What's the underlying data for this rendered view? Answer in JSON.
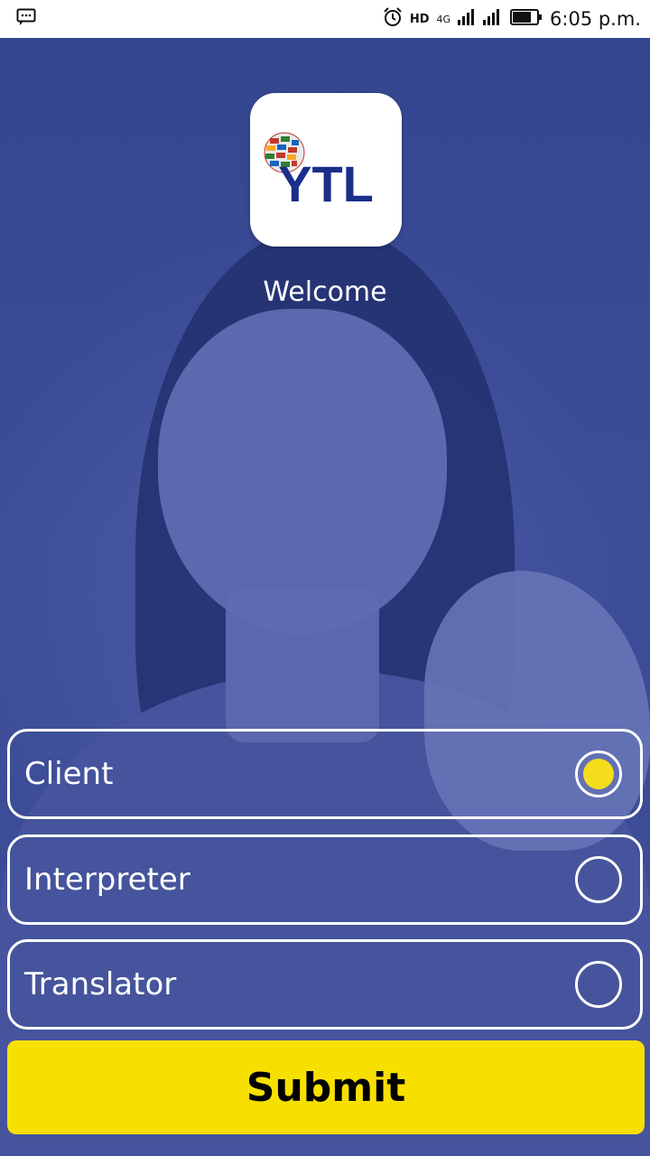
{
  "status_bar": {
    "notification_icon": "message-icon",
    "network_label": "4G",
    "hd_label": "HD",
    "time": "6:05 p.m."
  },
  "logo": {
    "text": "YTL",
    "brand_color": "#1a2e8a"
  },
  "welcome": "Welcome",
  "options": [
    {
      "label": "Client",
      "selected": true
    },
    {
      "label": "Interpreter",
      "selected": false
    },
    {
      "label": "Translator",
      "selected": false
    }
  ],
  "submit_label": "Submit",
  "colors": {
    "background": "#3b4a93",
    "accent": "#f7e000",
    "radio_selected": "#f4dd1a"
  }
}
